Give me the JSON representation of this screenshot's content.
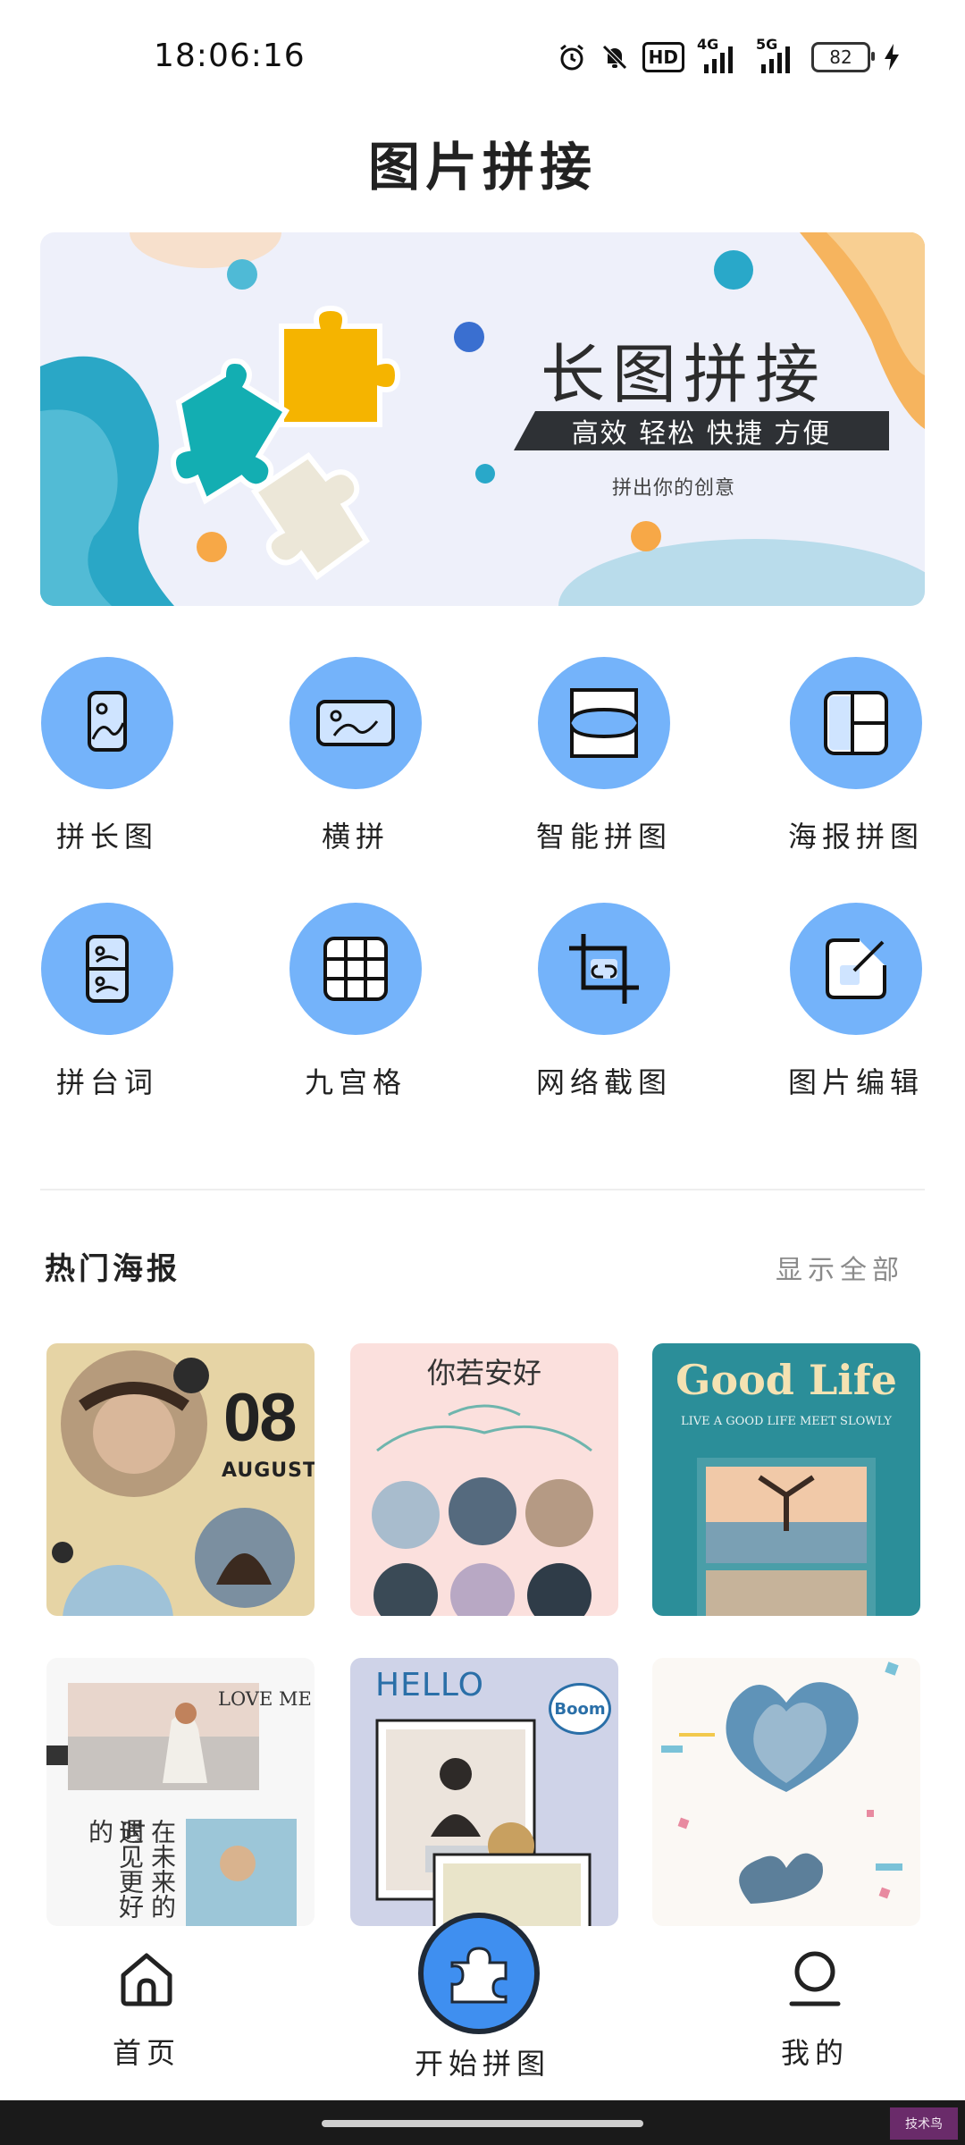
{
  "status_bar": {
    "time": "18:06:16",
    "battery": "82",
    "icons": [
      "alarm-icon",
      "mute-icon",
      "hd-icon",
      "4g-signal-icon",
      "5g-signal-icon",
      "battery-icon",
      "charging-icon"
    ],
    "hd_label": "HD",
    "net1": "4G",
    "net2": "5G"
  },
  "header": {
    "title": "图片拼接"
  },
  "banner": {
    "title": "长图拼接",
    "tagline": "高效 轻松 快捷 方便",
    "subtitle": "拼出你的创意"
  },
  "features": [
    {
      "label": "拼长图",
      "icon": "long-image-icon"
    },
    {
      "label": "横拼",
      "icon": "horizontal-image-icon"
    },
    {
      "label": "智能拼图",
      "icon": "smart-collage-icon"
    },
    {
      "label": "海报拼图",
      "icon": "poster-collage-icon"
    },
    {
      "label": "拼台词",
      "icon": "subtitle-collage-icon"
    },
    {
      "label": "九宫格",
      "icon": "grid-icon"
    },
    {
      "label": "网络截图",
      "icon": "web-screenshot-icon"
    },
    {
      "label": "图片编辑",
      "icon": "image-edit-icon"
    }
  ],
  "section": {
    "title": "热门海报",
    "more": "显示全部"
  },
  "posters": {
    "p1": {
      "day": "08",
      "month": "AUGUST"
    },
    "p2": {
      "title": "你若安好"
    },
    "p3": {
      "title": "Good Life",
      "subtitle": "LIVE A GOOD LIFE MEET SLOWLY"
    },
    "p4": {
      "title": "LOVE ME",
      "line1": "遇见更好的",
      "line2": "在未来的时"
    },
    "p5": {
      "title": "HELLO",
      "badge": "Boom"
    },
    "p6": {}
  },
  "bottom_nav": {
    "home": "首页",
    "start": "开始拼图",
    "mine": "我的"
  },
  "watermark": "技术鸟",
  "colors": {
    "accent": "#74b3fa",
    "nav_center": "#3f8ff0",
    "banner_bg": "#eef0fa",
    "tagline_bg": "#2e3135"
  }
}
